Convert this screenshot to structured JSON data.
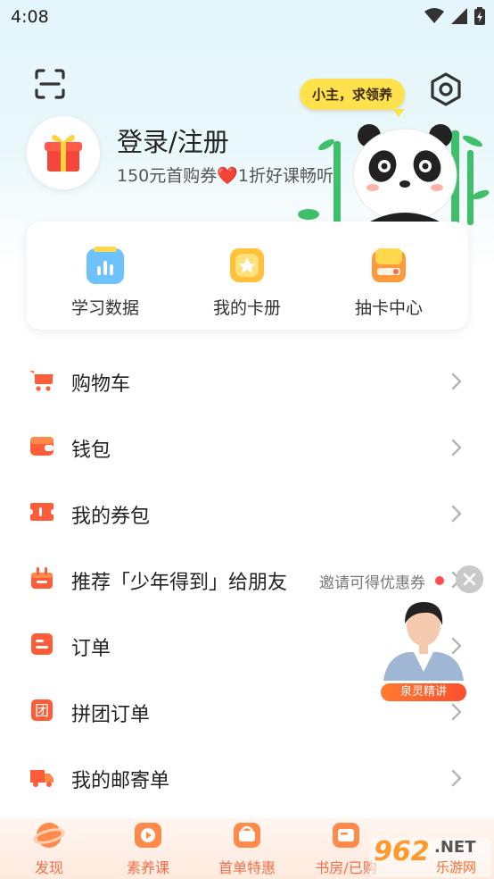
{
  "status_bar": {
    "time": "4:08"
  },
  "header": {
    "bubble": "小主，求领养",
    "login_text": "登录/注册",
    "subtitle": "150元首购券❤️1折好课畅听"
  },
  "quick_actions": [
    {
      "label": "学习数据",
      "icon": "bar-chart-icon"
    },
    {
      "label": "我的卡册",
      "icon": "star-card-icon"
    },
    {
      "label": "抽卡中心",
      "icon": "card-draw-icon"
    }
  ],
  "menu": [
    {
      "label": "购物车",
      "icon": "cart-icon"
    },
    {
      "label": "钱包",
      "icon": "wallet-icon"
    },
    {
      "label": "我的券包",
      "icon": "coupon-icon"
    },
    {
      "label": "推荐「少年得到」给朋友",
      "icon": "gift-box-icon",
      "hint": "邀请可得优惠券"
    },
    {
      "label": "订单",
      "icon": "order-icon"
    },
    {
      "label": "拼团订单",
      "icon": "group-order-icon",
      "icon_text": "团"
    },
    {
      "label": "我的邮寄单",
      "icon": "truck-icon"
    }
  ],
  "floating_promo": {
    "label": "泉灵精讲"
  },
  "tabs": [
    {
      "label": "发现",
      "icon": "planet-icon"
    },
    {
      "label": "素养课",
      "icon": "play-tv-icon"
    },
    {
      "label": "首单特惠",
      "icon": "basket-icon"
    },
    {
      "label": "书房/已购",
      "icon": "bookshelf-icon"
    }
  ],
  "watermark": {
    "number": "962",
    "suffix": ".NET",
    "text": "乐游网"
  },
  "colors": {
    "accent": "#f36f4a",
    "bubble": "#ffe14d",
    "hero_top": "#e3f5fb"
  }
}
